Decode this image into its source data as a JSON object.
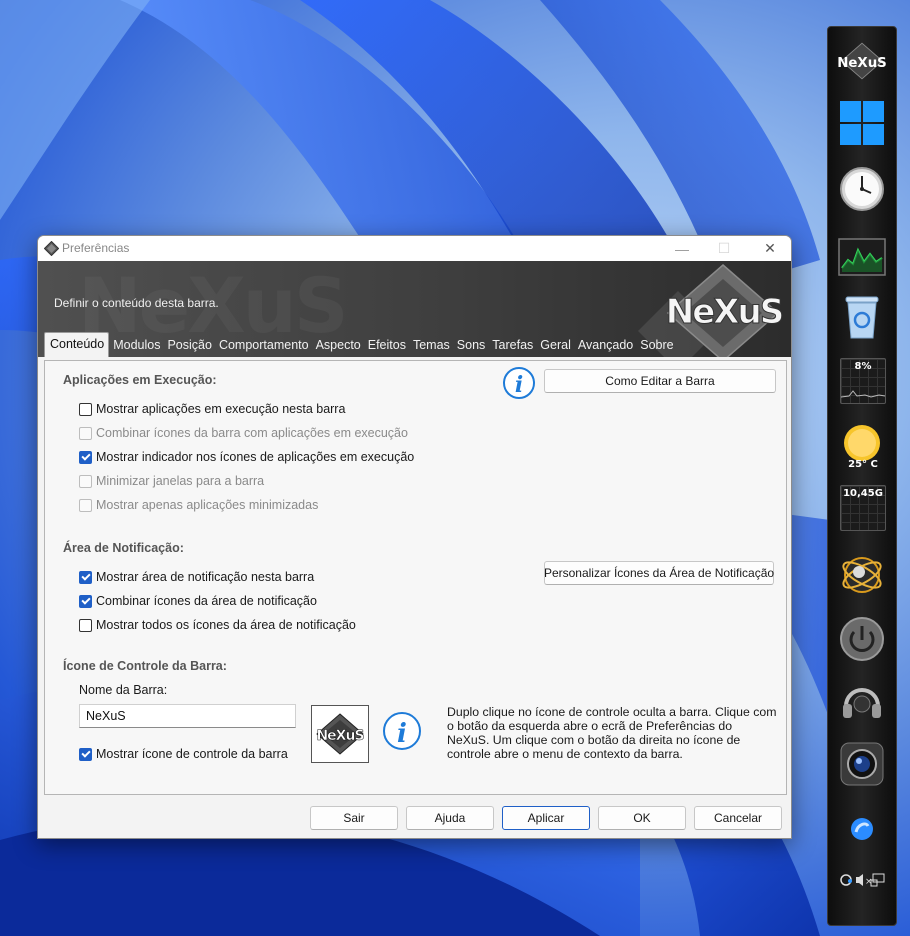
{
  "window": {
    "title": "Preferências",
    "minimize_glyph": "—",
    "maximize_glyph": "☐",
    "close_glyph": "✕"
  },
  "banner": {
    "subtitle": "Definir o conteúdo desta barra.",
    "logo_text": "NeXuS",
    "watermark_text": "NeXuS"
  },
  "tabs": [
    {
      "label": "Conteúdo",
      "active": true
    },
    {
      "label": "Modulos",
      "active": false
    },
    {
      "label": "Posição",
      "active": false
    },
    {
      "label": "Comportamento",
      "active": false
    },
    {
      "label": "Aspecto",
      "active": false
    },
    {
      "label": "Efeitos",
      "active": false
    },
    {
      "label": "Temas",
      "active": false
    },
    {
      "label": "Sons",
      "active": false
    },
    {
      "label": "Tarefas",
      "active": false
    },
    {
      "label": "Geral",
      "active": false
    },
    {
      "label": "Avançado",
      "active": false
    },
    {
      "label": "Sobre",
      "active": false
    }
  ],
  "running_apps": {
    "title": "Aplicações em Execução:",
    "how_to_button": "Como Editar a Barra",
    "options": [
      {
        "label": "Mostrar aplicações em execução nesta barra",
        "checked": false,
        "enabled": true
      },
      {
        "label": "Combinar ícones da barra com aplicações em execução",
        "checked": false,
        "enabled": false
      },
      {
        "label": "Mostrar indicador nos ícones de aplicações em execução",
        "checked": true,
        "enabled": true
      },
      {
        "label": "Minimizar janelas para a barra",
        "checked": false,
        "enabled": false
      },
      {
        "label": "Mostrar apenas aplicações minimizadas",
        "checked": false,
        "enabled": false
      }
    ]
  },
  "notification_area": {
    "title": "Área de Notificação:",
    "customize_button": "Personalizar Ícones da Área de Notificação",
    "options": [
      {
        "label": "Mostrar área de notificação nesta barra",
        "checked": true,
        "enabled": true
      },
      {
        "label": "Combinar ícones da área de notificação",
        "checked": true,
        "enabled": true
      },
      {
        "label": "Mostrar todos os ícones da área de notificação",
        "checked": false,
        "enabled": true
      }
    ]
  },
  "control_icon": {
    "title": "Ícone de Controle da Barra:",
    "name_label": "Nome da Barra:",
    "name_value": "NeXuS",
    "show_icon_label": "Mostrar ícone de controle da barra",
    "show_icon_checked": true,
    "logo_text": "NeXuS",
    "help_text": "Duplo clique no ícone de controle oculta a barra. Clique com o botão da esquerda abre o ecrã de Preferências do NeXuS. Um clique com o botão da direita no ícone de controle abre o menu de contexto da barra."
  },
  "footer": {
    "exit": "Sair",
    "help": "Ajuda",
    "apply": "Aplicar",
    "ok": "OK",
    "cancel": "Cancelar"
  },
  "dock": {
    "logo_text": "NeXuS",
    "cpu_label": "8%",
    "weather_label": "25° C",
    "disk_label": "10,45G",
    "colors": {
      "dock_bg": "#1a1a1a",
      "accent": "#1f5fc7"
    }
  }
}
